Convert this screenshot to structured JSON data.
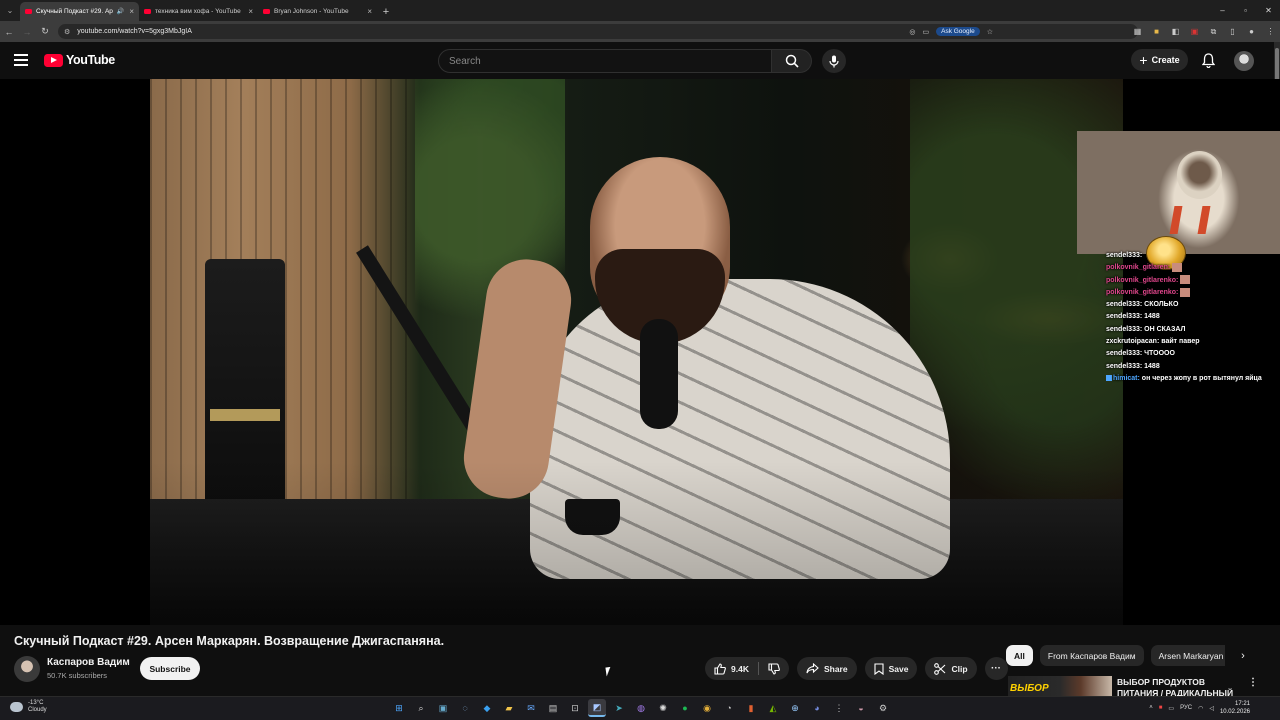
{
  "browser": {
    "tabs": [
      {
        "title": "Скучный Подкаст #29. Ар",
        "active": true,
        "audio": true
      },
      {
        "title": "техника вим хофа - YouTube",
        "active": false
      },
      {
        "title": "Bryan Johnson - YouTube",
        "active": false
      }
    ],
    "url": "youtube.com/watch?v=5gxg3MbJgIA",
    "ask_google": "Ask Google"
  },
  "masthead": {
    "logo_text": "YouTube",
    "search_placeholder": "Search",
    "create_label": "Create"
  },
  "overlay": {
    "chat": [
      {
        "nick": "sendel333:",
        "text": "",
        "color": "white"
      },
      {
        "nick": "polkovnik_gitlaren:",
        "text": "",
        "color": "pink",
        "emote": true
      },
      {
        "nick": "polkovnik_gitlarenko:",
        "text": "",
        "color": "pink",
        "emote": true
      },
      {
        "nick": "polkovnik_gitlarenko:",
        "text": "",
        "color": "pink",
        "emote": true
      },
      {
        "nick": "sendel333:",
        "text": "СКОЛЬКО",
        "color": "white"
      },
      {
        "nick": "sendel333:",
        "text": "1488",
        "color": "white"
      },
      {
        "nick": "sendel333:",
        "text": "ОН СКАЗАЛ",
        "color": "white"
      },
      {
        "nick": "zxckrutoipacan:",
        "text": "вайт павер",
        "color": "white"
      },
      {
        "nick": "sendel333:",
        "text": "ЧТОООО",
        "color": "white"
      },
      {
        "nick": "sendel333:",
        "text": "1488",
        "color": "white"
      },
      {
        "nick": "himicat:",
        "text": "он через жопу в рот вытянул яйца",
        "color": "cyan",
        "badge": true
      }
    ]
  },
  "video": {
    "title": "Скучный Подкаст #29. Арсен Маркарян. Возвращение Джигаспаняна.",
    "channel": "Каспаров Вадим",
    "subscribers": "50.7K subscribers",
    "subscribe_label": "Subscribe",
    "likes": "9.4K",
    "share_label": "Share",
    "save_label": "Save",
    "clip_label": "Clip"
  },
  "sidebar": {
    "chips": [
      "All",
      "From Каспаров Вадим",
      "Arsen Markaryan"
    ],
    "rec": {
      "thumb_text": "ВЫБОР",
      "title": "ВЫБОР ПРОДУКТОВ ПИТАНИЯ / РАДИКАЛЬНЫЙ"
    }
  },
  "taskbar": {
    "weather_temp": "-13°C",
    "weather_desc": "Cloudy",
    "lang": "РУС",
    "time": "17:21",
    "date": "10.02.2026"
  },
  "colors": {
    "youtube_red": "#ff0033",
    "page_bg": "#0f0f0f",
    "pill_bg": "#272727"
  }
}
